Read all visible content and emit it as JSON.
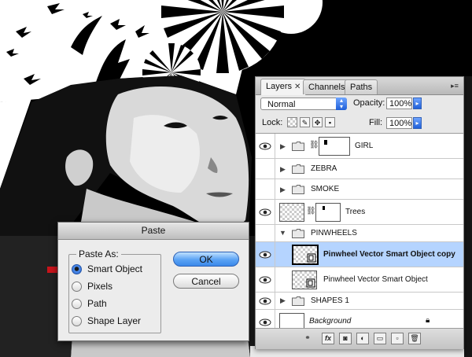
{
  "layers_panel": {
    "tabs": [
      {
        "label": "Layers",
        "close": "✕"
      },
      {
        "label": "Channels"
      },
      {
        "label": "Paths"
      }
    ],
    "blend_mode": "Normal",
    "opacity_label": "Opacity:",
    "opacity_value": "100%",
    "lock_label": "Lock:",
    "fill_label": "Fill:",
    "fill_value": "100%",
    "layers": [
      {
        "name": "GIRL",
        "kind": "group",
        "expanded": false
      },
      {
        "name": "ZEBRA",
        "kind": "group",
        "expanded": false
      },
      {
        "name": "SMOKE",
        "kind": "group",
        "expanded": false
      },
      {
        "name": "Trees",
        "kind": "layer"
      },
      {
        "name": "PINWHEELS",
        "kind": "group",
        "expanded": true
      },
      {
        "name": "Pinwheel Vector Smart Object copy",
        "kind": "smart-object",
        "selected": true
      },
      {
        "name": "Pinwheel Vector Smart Object",
        "kind": "smart-object"
      },
      {
        "name": "SHAPES 1",
        "kind": "group",
        "expanded": false
      },
      {
        "name": "Background",
        "kind": "background",
        "locked": true
      }
    ],
    "bottom_icons": [
      "link-icon",
      "fx-icon",
      "mask-icon",
      "adjustment-icon",
      "new-group-icon",
      "new-layer-icon",
      "trash-icon"
    ],
    "fx_label": "fx"
  },
  "paste_dialog": {
    "title": "Paste",
    "group_label": "Paste As:",
    "options": [
      "Smart Object",
      "Pixels",
      "Path",
      "Shape Layer"
    ],
    "selected_option": "Smart Object",
    "ok_label": "OK",
    "cancel_label": "Cancel"
  },
  "colors": {
    "selection_blue": "#b5d4ff",
    "pointer_arrow_red": "#c8141b",
    "default_button_blue": "#3b89ea"
  }
}
